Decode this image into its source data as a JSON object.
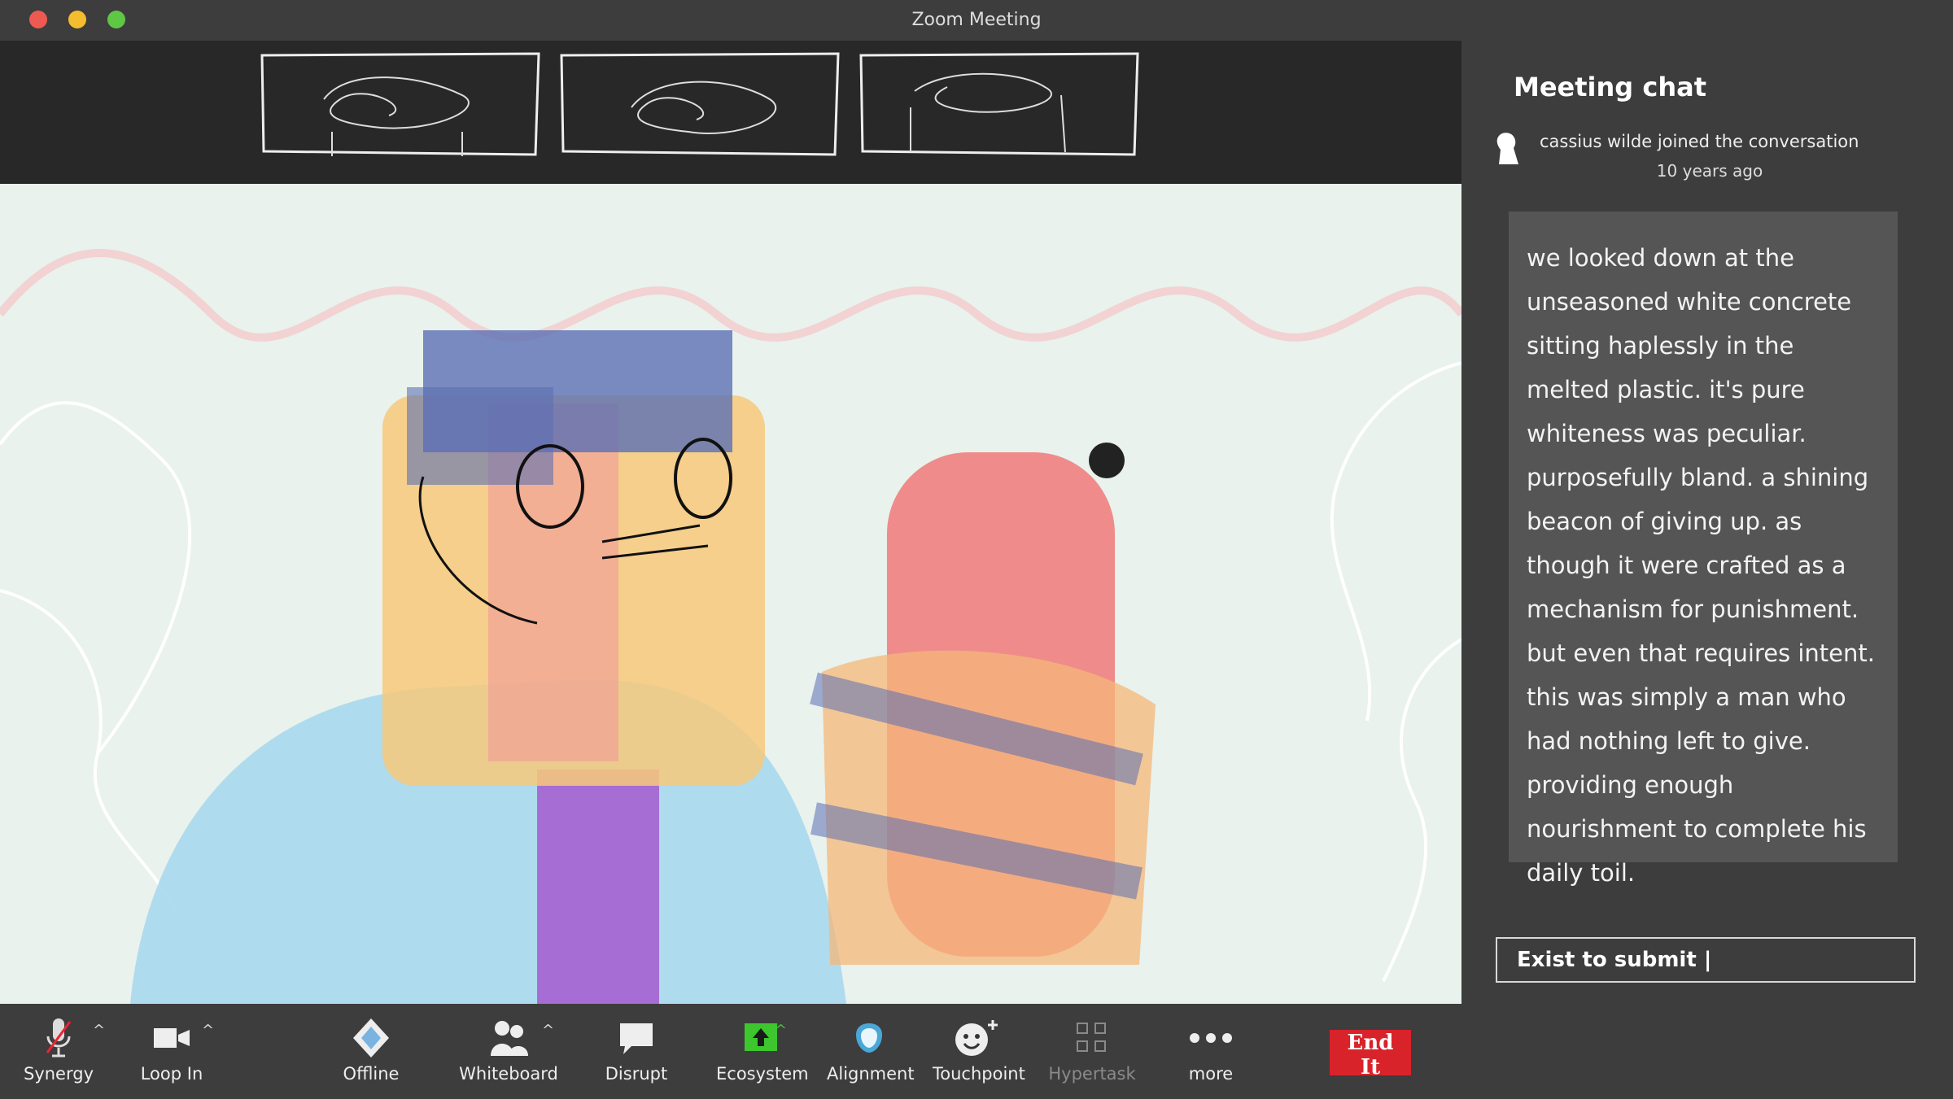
{
  "window": {
    "title": "Zoom Meeting"
  },
  "chat": {
    "title": "Meeting chat",
    "join_notice": "cassius wilde joined the conversation",
    "join_time": "10 years ago",
    "message": "we looked down at the unseasoned white concrete sitting haplessly in the melted plastic. it's pure whiteness was peculiar. purposefully bland. a shining beacon of giving up. as though it were crafted as a mechanism for punishment. but even that requires intent. this was simply a man who had nothing left to give. providing enough nourishment to complete his daily toil.",
    "input_value": "Exist to submit |"
  },
  "toolbar": {
    "synergy": "Synergy",
    "loop_in": "Loop In",
    "offline": "Offline",
    "whiteboard": "Whiteboard",
    "disrupt": "Disrupt",
    "ecosystem": "Ecosystem",
    "alignment": "Alignment",
    "touchpoint": "Touchpoint",
    "hypertask": "Hypertask",
    "more": "more",
    "end": "End It"
  },
  "colors": {
    "end_button": "#d9232b",
    "ecosystem_icon": "#3ec62f",
    "alignment_icon": "#4aa7d8"
  }
}
